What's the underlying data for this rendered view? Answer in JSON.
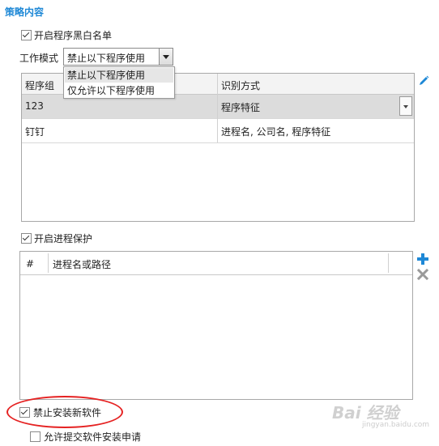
{
  "section_title": "策略内容",
  "app_blacklist": {
    "label": "开启程序黑白名单",
    "checked": true
  },
  "work_mode": {
    "label": "工作模式",
    "selected": "禁止以下程序使用",
    "options": [
      "禁止以下程序使用",
      "仅允许以下程序使用"
    ]
  },
  "program_table": {
    "columns": [
      "程序组",
      "识别方式"
    ],
    "rows": [
      {
        "group": "123",
        "method": "程序特征"
      },
      {
        "group": "钉钉",
        "method": "进程名, 公司名, 程序特征"
      }
    ]
  },
  "process_protect": {
    "label": "开启进程保护",
    "checked": true
  },
  "process_table": {
    "columns": [
      "#",
      "进程名或路径"
    ]
  },
  "forbid_install": {
    "label": "禁止安装新软件",
    "checked": true
  },
  "allow_request": {
    "label": "允许提交软件安装申请",
    "checked": false
  },
  "icons": {
    "edit": "pencil-icon",
    "add": "plus-icon",
    "delete": "close-icon"
  },
  "colors": {
    "accent": "#1e88d6",
    "highlight": "#e52222"
  },
  "watermark": {
    "text": "Bai 经验",
    "sub": "jingyan.baidu.com"
  }
}
